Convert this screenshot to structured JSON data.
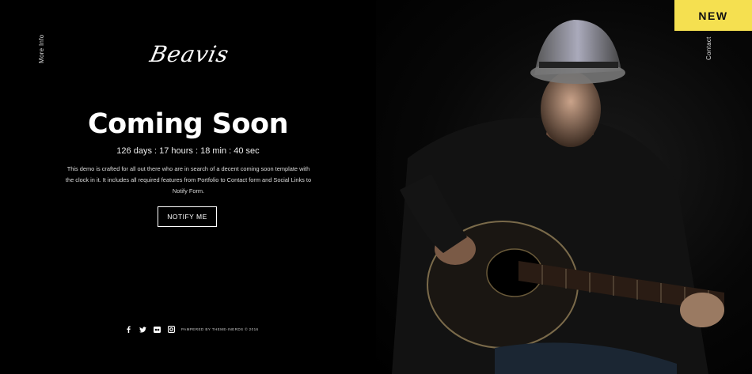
{
  "nav": {
    "more_info": "More Info",
    "contact": "Contact"
  },
  "badge": "NEW",
  "logo": "Beavis",
  "hero": {
    "title": "Coming Soon",
    "countdown": "126 days : 17 hours : 18 min : 40 sec",
    "description": "This demo is crafted for all out there who are in search of a decent coming soon template with the clock in it. It includes all required features from Portfolio to Contact form and Social Links to Notify Form.",
    "notify_label": "NOTIFY ME"
  },
  "footer": {
    "social_icons": [
      "facebook-icon",
      "twitter-icon",
      "flickr-icon",
      "instagram-icon"
    ],
    "credit": "PAMPERED BY THEME-INERDS © 2016"
  },
  "colors": {
    "background": "#000000",
    "badge": "#f5e050",
    "text": "#ffffff"
  }
}
